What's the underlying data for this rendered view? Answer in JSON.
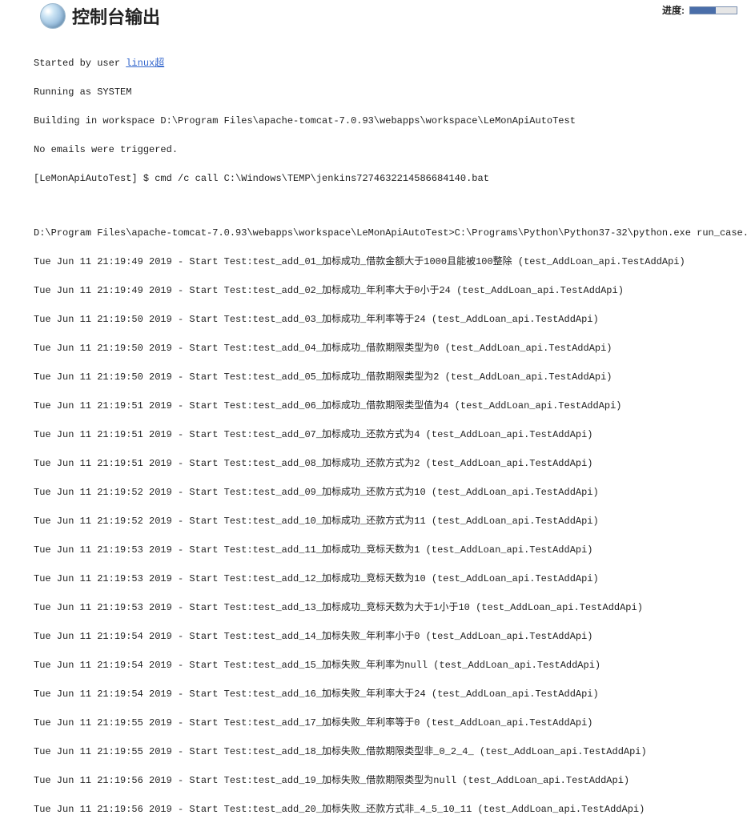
{
  "header": {
    "title": "控制台输出",
    "progress_label": "进度:"
  },
  "console": {
    "prefix_started": "Started by user ",
    "user_link": "linux超",
    "line_running": "Running as SYSTEM",
    "line_workspace": "Building in workspace D:\\Program Files\\apache-tomcat-7.0.93\\webapps\\workspace\\LeMonApiAutoTest",
    "line_emails": "No emails were triggered.",
    "line_cmd": "[LeMonApiAutoTest] $ cmd /c call C:\\Windows\\TEMP\\jenkins7274632214586684140.bat",
    "line_exec": "D:\\Program Files\\apache-tomcat-7.0.93\\webapps\\workspace\\LeMonApiAutoTest>C:\\Programs\\Python\\Python37-32\\python.exe run_case.py",
    "tests": [
      "Tue Jun 11 21:19:49 2019 - Start Test:test_add_01_加标成功_借款金额大于1000且能被100整除 (test_AddLoan_api.TestAddApi)",
      "Tue Jun 11 21:19:49 2019 - Start Test:test_add_02_加标成功_年利率大于0小于24 (test_AddLoan_api.TestAddApi)",
      "Tue Jun 11 21:19:50 2019 - Start Test:test_add_03_加标成功_年利率等于24 (test_AddLoan_api.TestAddApi)",
      "Tue Jun 11 21:19:50 2019 - Start Test:test_add_04_加标成功_借款期限类型为0 (test_AddLoan_api.TestAddApi)",
      "Tue Jun 11 21:19:50 2019 - Start Test:test_add_05_加标成功_借款期限类型为2 (test_AddLoan_api.TestAddApi)",
      "Tue Jun 11 21:19:51 2019 - Start Test:test_add_06_加标成功_借款期限类型值为4 (test_AddLoan_api.TestAddApi)",
      "Tue Jun 11 21:19:51 2019 - Start Test:test_add_07_加标成功_还款方式为4 (test_AddLoan_api.TestAddApi)",
      "Tue Jun 11 21:19:51 2019 - Start Test:test_add_08_加标成功_还款方式为2 (test_AddLoan_api.TestAddApi)",
      "Tue Jun 11 21:19:52 2019 - Start Test:test_add_09_加标成功_还款方式为10 (test_AddLoan_api.TestAddApi)",
      "Tue Jun 11 21:19:52 2019 - Start Test:test_add_10_加标成功_还款方式为11 (test_AddLoan_api.TestAddApi)",
      "Tue Jun 11 21:19:53 2019 - Start Test:test_add_11_加标成功_竞标天数为1 (test_AddLoan_api.TestAddApi)",
      "Tue Jun 11 21:19:53 2019 - Start Test:test_add_12_加标成功_竞标天数为10 (test_AddLoan_api.TestAddApi)",
      "Tue Jun 11 21:19:53 2019 - Start Test:test_add_13_加标成功_竞标天数为大于1小于10 (test_AddLoan_api.TestAddApi)",
      "Tue Jun 11 21:19:54 2019 - Start Test:test_add_14_加标失败_年利率小于0 (test_AddLoan_api.TestAddApi)",
      "Tue Jun 11 21:19:54 2019 - Start Test:test_add_15_加标失败_年利率为null (test_AddLoan_api.TestAddApi)",
      "Tue Jun 11 21:19:54 2019 - Start Test:test_add_16_加标失败_年利率大于24 (test_AddLoan_api.TestAddApi)",
      "Tue Jun 11 21:19:55 2019 - Start Test:test_add_17_加标失败_年利率等于0 (test_AddLoan_api.TestAddApi)",
      "Tue Jun 11 21:19:55 2019 - Start Test:test_add_18_加标失败_借款期限类型非_0_2_4_ (test_AddLoan_api.TestAddApi)",
      "Tue Jun 11 21:19:56 2019 - Start Test:test_add_19_加标失败_借款期限类型为null (test_AddLoan_api.TestAddApi)",
      "Tue Jun 11 21:19:56 2019 - Start Test:test_add_20_加标失败_还款方式非_4_5_10_11 (test_AddLoan_api.TestAddApi)"
    ]
  }
}
